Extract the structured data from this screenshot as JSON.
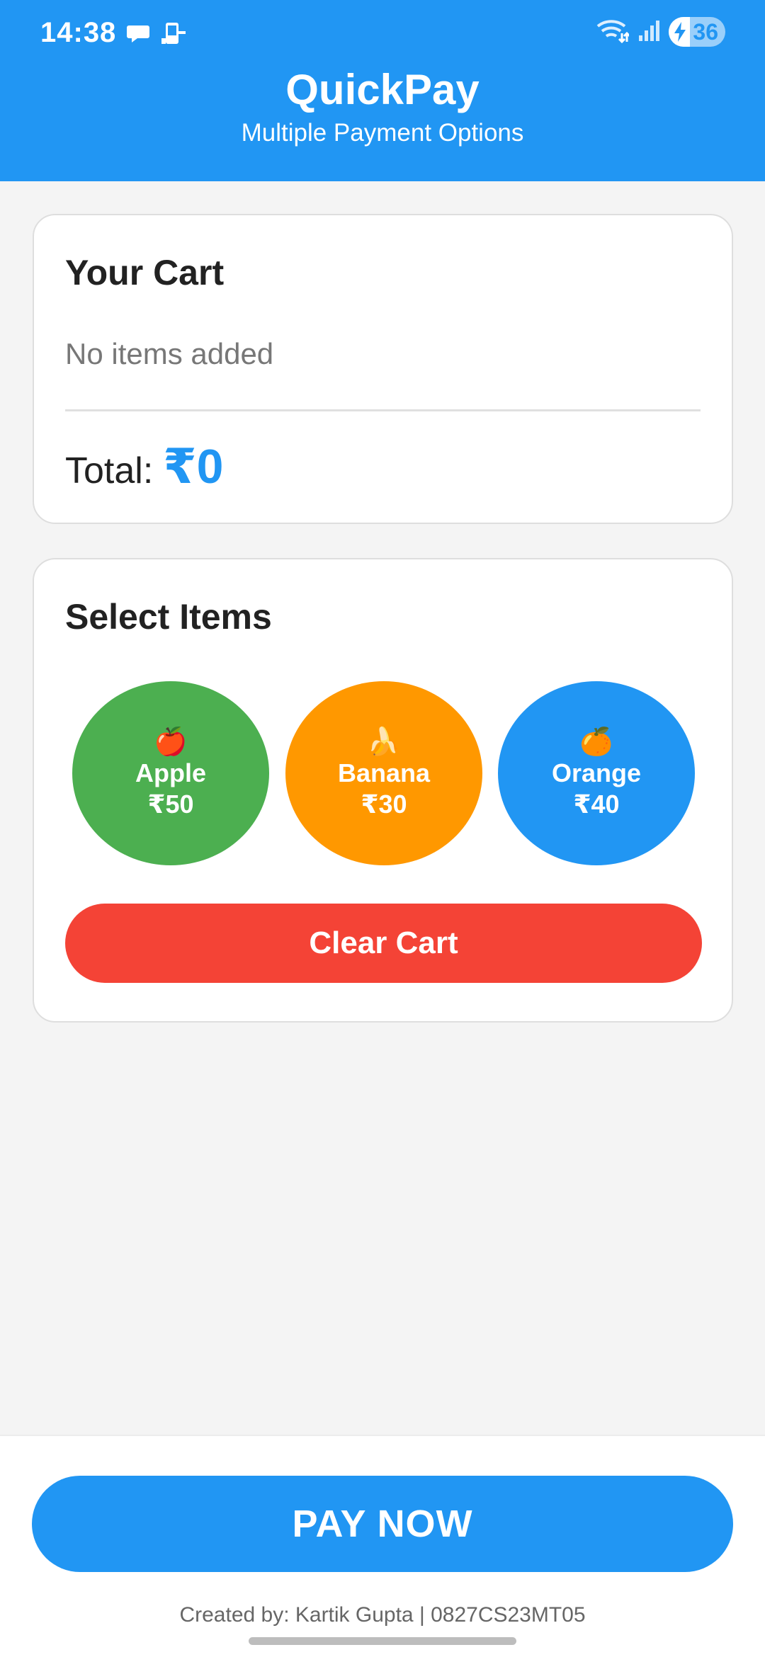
{
  "status_bar": {
    "time": "14:38",
    "battery_level": "36",
    "left_icons": [
      "chat-bubble-icon",
      "sim-phone-icon"
    ],
    "right_icons": [
      "wifi-icon",
      "signal-icon",
      "battery-icon"
    ]
  },
  "header": {
    "title": "QuickPay",
    "subtitle": "Multiple Payment Options",
    "color": "#2196f3"
  },
  "cart": {
    "title": "Your Cart",
    "empty_text": "No items added",
    "total_label": "Total:",
    "total_value": "₹0"
  },
  "items_section": {
    "title": "Select Items",
    "items": [
      {
        "emoji": "🍎",
        "name": "Apple",
        "price": "₹50",
        "color": "#4caf50"
      },
      {
        "emoji": "🍌",
        "name": "Banana",
        "price": "₹30",
        "color": "#ff9800"
      },
      {
        "emoji": "🍊",
        "name": "Orange",
        "price": "₹40",
        "color": "#2196f3"
      }
    ],
    "clear_label": "Clear Cart",
    "clear_color": "#f44336"
  },
  "footer": {
    "pay_label": "PAY NOW",
    "credit": "Created by: Kartik Gupta | 0827CS23MT05"
  }
}
